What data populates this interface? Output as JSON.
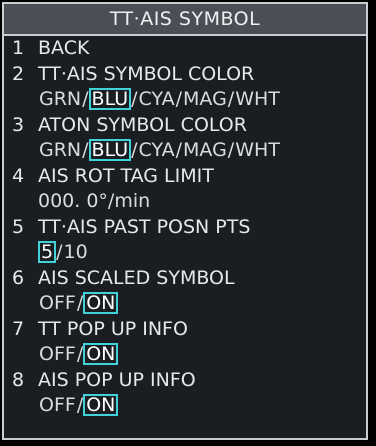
{
  "title": "TT·AIS SYMBOL",
  "colors": {
    "panel_background": "#1a1d22",
    "title_background": "#4a4e55",
    "border": "#c9cdd2",
    "selection_outline": "#3fd2d8"
  },
  "items": {
    "back": {
      "num": "1",
      "label": "BACK"
    },
    "tt_ais_symbol_color": {
      "num": "2",
      "label": "TT·AIS SYMBOL COLOR",
      "options": [
        "GRN",
        "BLU",
        "CYA",
        "MAG",
        "WHT"
      ],
      "selected": "BLU"
    },
    "aton_symbol_color": {
      "num": "3",
      "label": "ATON SYMBOL COLOR",
      "options": [
        "GRN",
        "BLU",
        "CYA",
        "MAG",
        "WHT"
      ],
      "selected": "BLU"
    },
    "ais_rot_tag_limit": {
      "num": "4",
      "label": "AIS ROT TAG LIMIT",
      "value": "000. 0°/min"
    },
    "tt_ais_past_posn_pts": {
      "num": "5",
      "label": "TT·AIS PAST POSN PTS",
      "options": [
        "5",
        "10"
      ],
      "selected": "5"
    },
    "ais_scaled_symbol": {
      "num": "6",
      "label": "AIS SCALED SYMBOL",
      "options": [
        "OFF",
        "ON"
      ],
      "selected": "ON"
    },
    "tt_pop_up_info": {
      "num": "7",
      "label": "TT POP UP INFO",
      "options": [
        "OFF",
        "ON"
      ],
      "selected": "ON"
    },
    "ais_pop_up_info": {
      "num": "8",
      "label": "AIS POP UP INFO",
      "options": [
        "OFF",
        "ON"
      ],
      "selected": "ON"
    }
  }
}
